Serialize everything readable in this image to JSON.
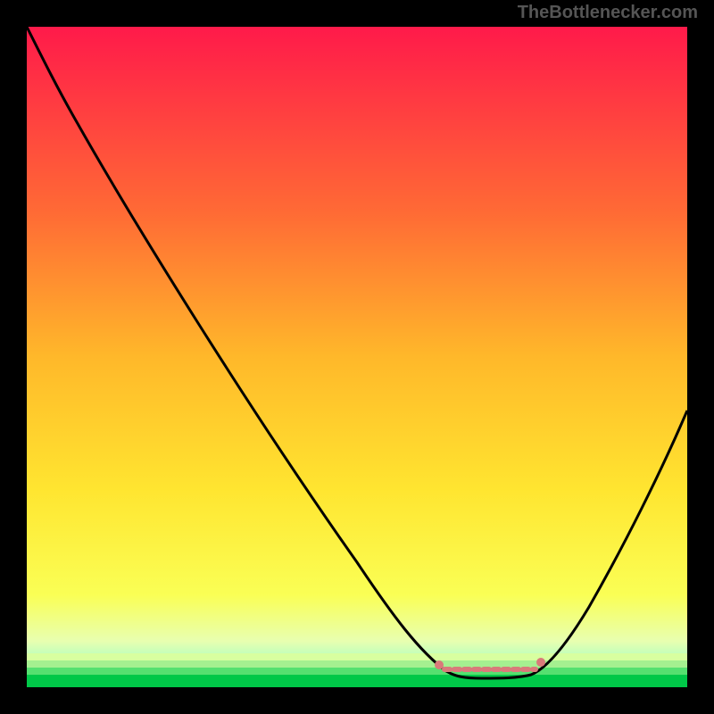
{
  "watermark": "TheBottlenecker.com",
  "chart_data": {
    "type": "line",
    "title": "",
    "xlabel": "",
    "ylabel": "",
    "xlim": [
      0,
      100
    ],
    "ylim": [
      0,
      100
    ],
    "background_gradient": {
      "top": "#ff1a4a",
      "mid_upper": "#ff8a2a",
      "mid": "#ffe030",
      "lower": "#f8ff60",
      "bottom_band": "#00e050"
    },
    "curve": {
      "name": "bottleneck-curve",
      "color": "#000000",
      "points": [
        {
          "x": 0,
          "y": 100
        },
        {
          "x": 5,
          "y": 94
        },
        {
          "x": 10,
          "y": 86
        },
        {
          "x": 20,
          "y": 70
        },
        {
          "x": 30,
          "y": 54
        },
        {
          "x": 40,
          "y": 38
        },
        {
          "x": 50,
          "y": 22
        },
        {
          "x": 58,
          "y": 8
        },
        {
          "x": 62,
          "y": 3
        },
        {
          "x": 65,
          "y": 1
        },
        {
          "x": 70,
          "y": 1
        },
        {
          "x": 75,
          "y": 1
        },
        {
          "x": 78,
          "y": 3
        },
        {
          "x": 82,
          "y": 9
        },
        {
          "x": 90,
          "y": 25
        },
        {
          "x": 100,
          "y": 46
        }
      ]
    },
    "optimal_band": {
      "x_start": 62,
      "x_end": 78,
      "y": 2,
      "marker_color": "#d97a7a"
    }
  }
}
